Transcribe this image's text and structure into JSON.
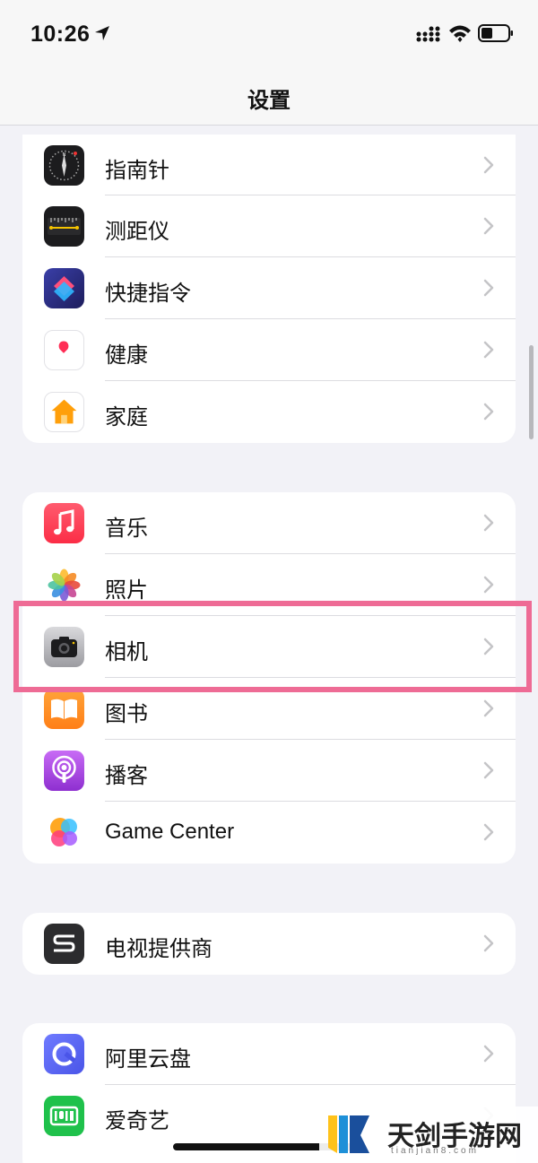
{
  "status_bar": {
    "time": "10:26"
  },
  "nav": {
    "title": "设置"
  },
  "groups": [
    {
      "items": [
        {
          "label": "指南针",
          "icon": "compass-icon"
        },
        {
          "label": "测距仪",
          "icon": "measure-icon"
        },
        {
          "label": "快捷指令",
          "icon": "shortcuts-icon"
        },
        {
          "label": "健康",
          "icon": "health-icon"
        },
        {
          "label": "家庭",
          "icon": "home-icon"
        }
      ]
    },
    {
      "items": [
        {
          "label": "音乐",
          "icon": "music-icon"
        },
        {
          "label": "照片",
          "icon": "photos-icon"
        },
        {
          "label": "相机",
          "icon": "camera-icon",
          "highlighted": true
        },
        {
          "label": "图书",
          "icon": "books-icon"
        },
        {
          "label": "播客",
          "icon": "podcasts-icon"
        },
        {
          "label": "Game Center",
          "icon": "game-center-icon"
        }
      ]
    },
    {
      "items": [
        {
          "label": "电视提供商",
          "icon": "tv-provider-icon"
        }
      ]
    },
    {
      "items": [
        {
          "label": "阿里云盘",
          "icon": "aliyun-drive-icon"
        },
        {
          "label": "爱奇艺",
          "icon": "iqiyi-icon"
        }
      ]
    }
  ],
  "watermark": {
    "title": "天剑手游网",
    "subtitle": "tianjian8.com"
  },
  "colors": {
    "highlight": "#ee6b95",
    "background": "#f2f2f7"
  }
}
